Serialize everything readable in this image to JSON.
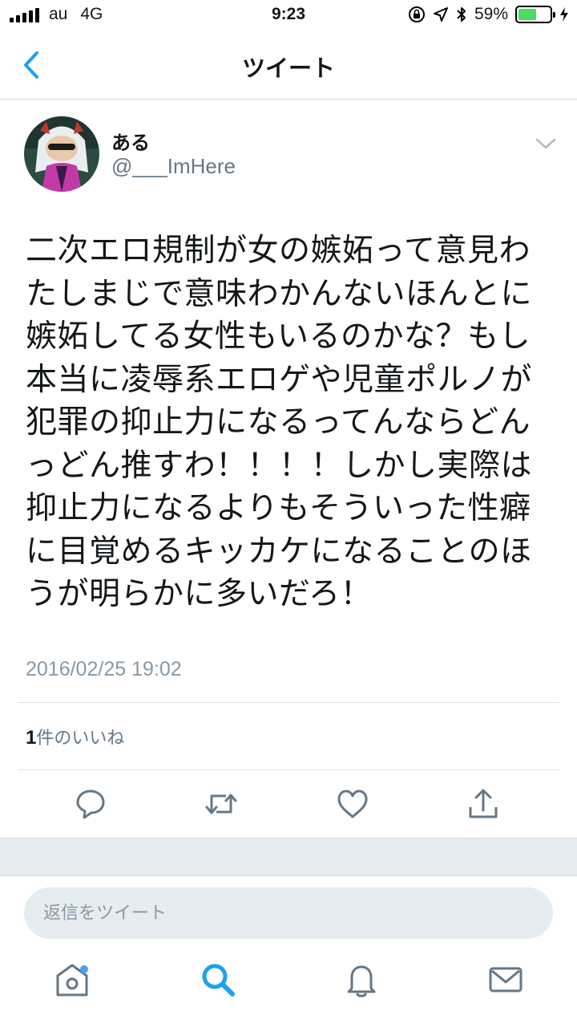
{
  "status_bar": {
    "carrier": "au",
    "network": "4G",
    "time": "9:23",
    "battery": "59%",
    "battery_level": 0.59,
    "battery_color": "#4cd964"
  },
  "nav": {
    "title": "ツイート",
    "back_icon": "chevron-left-icon"
  },
  "tweet": {
    "display_name": "ある",
    "handle": "@___ImHere",
    "lines": [
      "二次エロ規制が女の嫉妬って意見わ",
      "たしまじで意味わかんないほんとに",
      "嫉妬してる女性もいるのかな？もし",
      "本当に凌辱系エロゲや児童ポルノが",
      "犯罪の抑止力になるってんならどん",
      "っどん推すわ！！！！しかし実際は",
      "抑止力になるよりもそういった性癖",
      "に目覚めるキッカケになることのほ",
      "うが明らかに多いだろ！"
    ],
    "timestamp": "2016/02/25 19:02",
    "like_count": "1",
    "like_label": "件のいいね"
  },
  "actions": [
    "reply-icon",
    "retweet-icon",
    "like-icon",
    "share-icon"
  ],
  "reply": {
    "placeholder": "返信をツイート"
  },
  "tabbar": {
    "items": [
      "home-icon",
      "search-icon",
      "notifications-icon",
      "messages-icon"
    ],
    "active": "search-icon"
  },
  "colors": {
    "accent": "#1da1f2",
    "icon_gray": "#657786",
    "text": "#14171a",
    "secondary": "#8899a6",
    "notification_dot": "#4a9ff0"
  }
}
